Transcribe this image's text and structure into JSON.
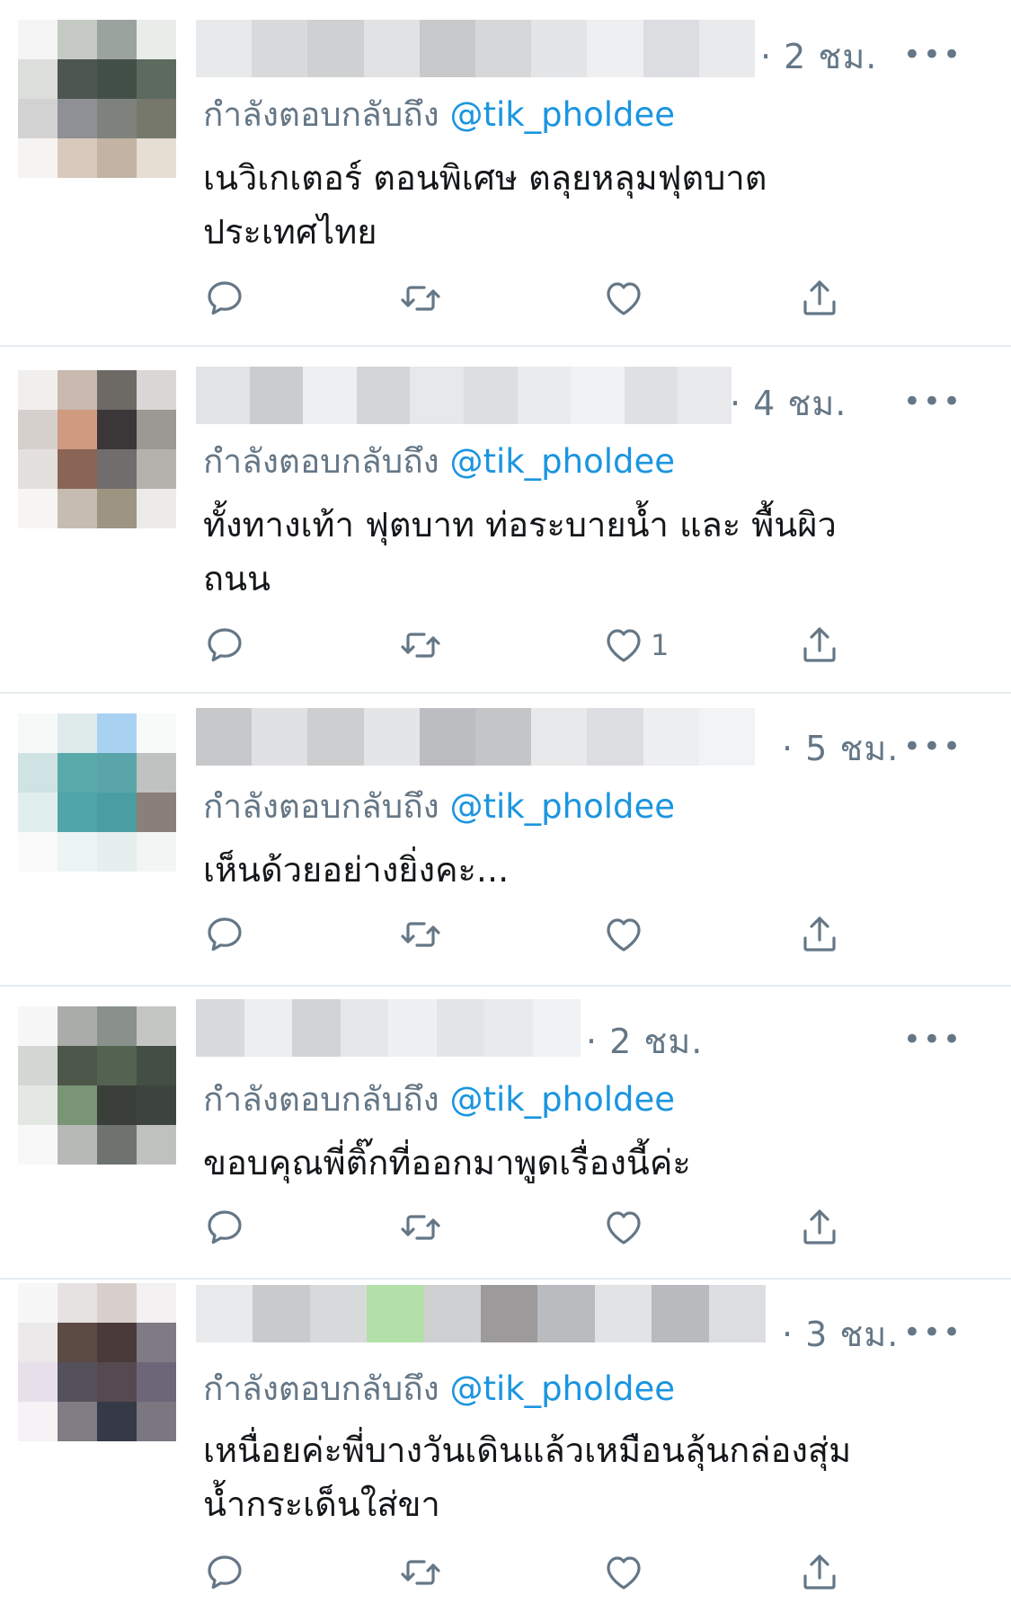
{
  "reply_prefix": "กำลังตอบกลับถึง",
  "reply_handle": "@tik_pholdee",
  "more_label": "•••",
  "icons": [
    "reply-icon",
    "retweet-icon",
    "like-icon",
    "share-icon"
  ],
  "colors": {
    "text": "#14171a",
    "secondary": "#657786",
    "link": "#1b95e0",
    "divider": "#e6ecf0"
  },
  "tweets": [
    {
      "time": "· 2 ชม.",
      "text_lines": [
        "เนวิเกเตอร์ ตอนพิเศษ ตลุยหลุมฟุตบาต",
        "ประเทศไทย"
      ],
      "like_count": ""
    },
    {
      "time": "· 4 ชม.",
      "text_lines": [
        "ทั้งทางเท้า ฟุตบาท ท่อระบายน้ำ และ พื้นผิว",
        "ถนน"
      ],
      "like_count": "1"
    },
    {
      "time": "· 5 ชม.",
      "text_lines": [
        "เห็นด้วยอย่างยิ่งคะ...",
        ""
      ],
      "like_count": ""
    },
    {
      "time": "· 2 ชม.",
      "text_lines": [
        "ขอบคุณพี่ติ๊กที่ออกมาพูดเรื่องนี้ค่ะ",
        ""
      ],
      "like_count": ""
    },
    {
      "time": "· 3 ชม.",
      "text_lines": [
        "เหนื่อยค่ะพี่บางวันเดินแล้วเหมือนลุ้นกล่องสุ่ม",
        "น้ำกระเด็นใส่ขา"
      ],
      "like_count": ""
    }
  ]
}
